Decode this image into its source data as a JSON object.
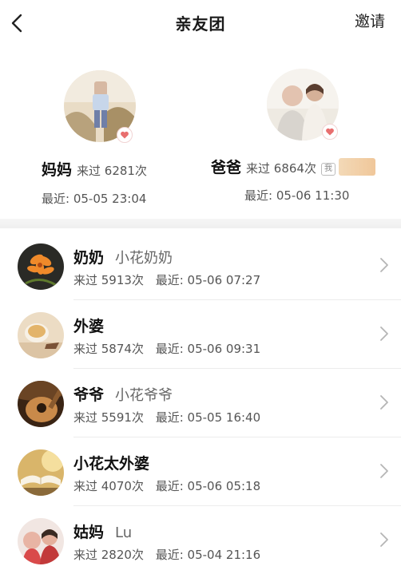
{
  "header": {
    "title": "亲友团",
    "invite_label": "邀请"
  },
  "top_members": [
    {
      "name": "妈妈",
      "visits": "来过 6281次",
      "recent": "最近: 05-05 23:04",
      "is_me": false
    },
    {
      "name": "爸爸",
      "visits": "来过 6864次",
      "recent": "最近: 05-06 11:30",
      "is_me": true,
      "me_label": "我"
    }
  ],
  "members": [
    {
      "name": "奶奶",
      "nickname": "小花奶奶",
      "visits": "来过 5913次",
      "recent": "最近: 05-06 07:27",
      "avatar": "flower-avatar"
    },
    {
      "name": "外婆",
      "nickname": "",
      "visits": "来过 5874次",
      "recent": "最近: 05-06 09:31",
      "avatar": "tea-cup-avatar"
    },
    {
      "name": "爷爷",
      "nickname": "小花爷爷",
      "visits": "来过 5591次",
      "recent": "最近: 05-05 16:40",
      "avatar": "guitar-avatar"
    },
    {
      "name": "小花太外婆",
      "nickname": "",
      "visits": "来过 4070次",
      "recent": "最近: 05-06 05:18",
      "avatar": "book-avatar"
    },
    {
      "name": "姑妈",
      "nickname": "Lu",
      "visits": "来过 2820次",
      "recent": "最近: 05-04 21:16",
      "avatar": "photo-avatar"
    }
  ],
  "icons": {
    "back": "chevron-left-icon",
    "row_arrow": "chevron-right-icon",
    "heart": "heart-icon"
  },
  "colors": {
    "heart": "#e86f6f",
    "text_primary": "#111111",
    "text_secondary": "#555555"
  }
}
